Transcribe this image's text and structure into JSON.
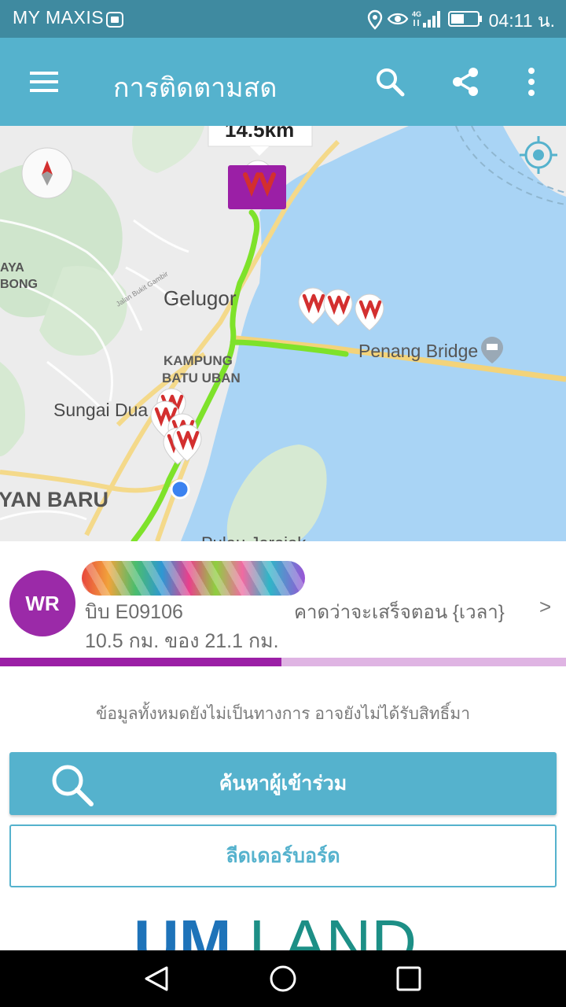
{
  "status_bar": {
    "carrier": "MY MAXIS",
    "time": "04:11 น."
  },
  "app_bar": {
    "title": "การติดตามสด"
  },
  "map": {
    "distance_label": "14.5km",
    "labels": {
      "gelugor": "Gelugor",
      "kampung_1": "KAMPUNG",
      "kampung_2": "BATU UBAN",
      "sungai_dua": "Sungai Dua",
      "penang_bridge": "Penang Bridge",
      "yan_baru": "YAN BARU",
      "aya": "AYA",
      "bong": "BONG",
      "pulau": "Pulau Jerejak",
      "road": "Jalan Bukit Gambir"
    }
  },
  "participant": {
    "initials": "WR",
    "bib": "บิบ E09106",
    "eta": "คาดว่าจะเสร็จตอน {เวลา}",
    "distance": "10.5 กม. ของ 21.1 กม.",
    "progress": 0.497
  },
  "disclaimer": "ข้อมูลทั้งหมดยังไม่เป็นทางการ อาจยังไม่ได้รับสิทธิ์มา",
  "buttons": {
    "search_participants": "ค้นหาผู้เข้าร่วม",
    "leaderboard": "ลีดเดอร์บอร์ด"
  },
  "logo": {
    "part1": "UM",
    "part2": "LAND"
  },
  "colors": {
    "primary": "#55b2cd",
    "status_bar": "#3f8aa0",
    "accent_purple": "#9b1fa6",
    "progress_track": "#dfb4e3",
    "route": "#7ee22a",
    "sea": "#a9d4f5"
  }
}
